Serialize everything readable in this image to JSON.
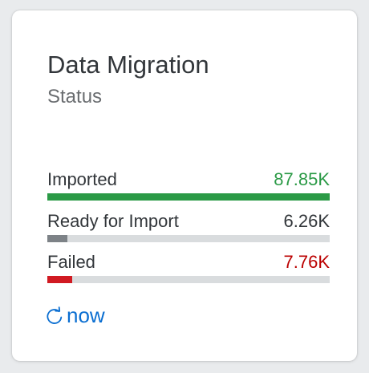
{
  "tile": {
    "title": "Data Migration",
    "subtitle": "Status",
    "metrics": [
      {
        "label": "Imported",
        "value": "87.85K",
        "fraction": 1.0,
        "color": "#2b9a46",
        "value_color": "#2b9a46"
      },
      {
        "label": "Ready for Import",
        "value": "6.26K",
        "fraction": 0.071,
        "color": "#7d8287",
        "value_color": "#32363a"
      },
      {
        "label": "Failed",
        "value": "7.76K",
        "fraction": 0.088,
        "color": "#d11a22",
        "value_color": "#bb0000"
      }
    ],
    "footer": {
      "icon": "refresh-icon",
      "text": "now",
      "color": "#0a6ed1"
    }
  }
}
